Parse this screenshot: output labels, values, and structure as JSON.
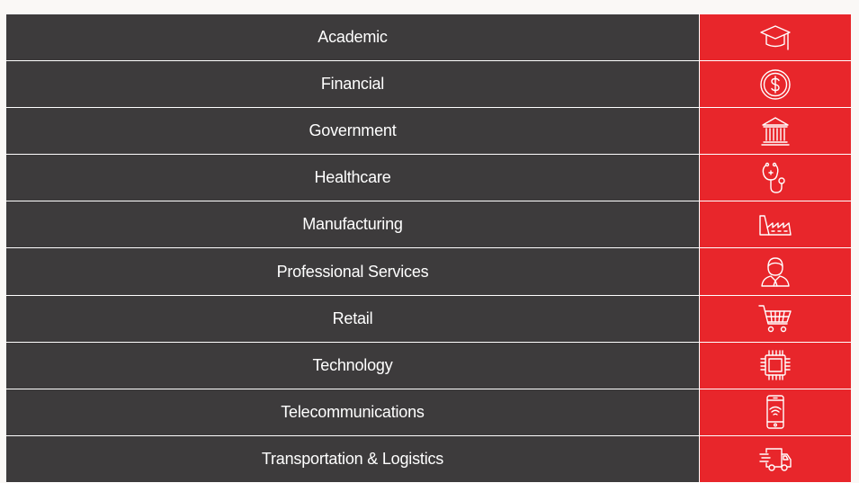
{
  "rows": [
    {
      "label": "Academic",
      "icon": "graduation-cap-icon"
    },
    {
      "label": "Financial",
      "icon": "dollar-coin-icon"
    },
    {
      "label": "Government",
      "icon": "government-building-icon"
    },
    {
      "label": "Healthcare",
      "icon": "stethoscope-icon"
    },
    {
      "label": "Manufacturing",
      "icon": "factory-icon"
    },
    {
      "label": "Professional Services",
      "icon": "professional-person-icon"
    },
    {
      "label": "Retail",
      "icon": "shopping-cart-icon"
    },
    {
      "label": "Technology",
      "icon": "microchip-icon"
    },
    {
      "label": "Telecommunications",
      "icon": "mobile-phone-wifi-icon"
    },
    {
      "label": "Transportation & Logistics",
      "icon": "delivery-truck-icon"
    }
  ],
  "colors": {
    "label_background": "#3d3b3c",
    "icon_background": "#e8262b",
    "text": "#ffffff",
    "page_background": "#faf8f6"
  }
}
